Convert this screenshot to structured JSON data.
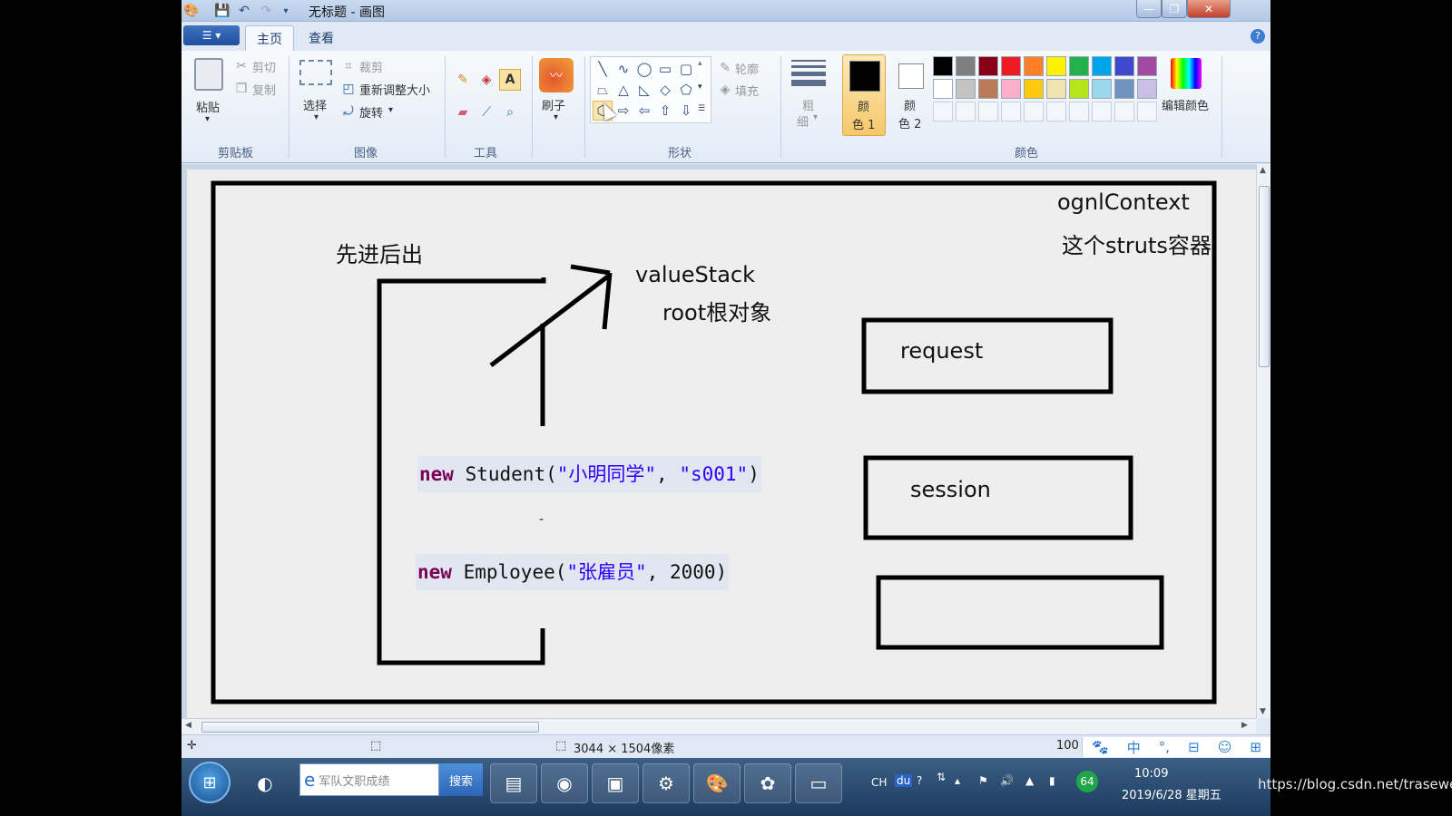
{
  "window": {
    "title": "无标题 - 画图",
    "min_btn": "—",
    "max_btn": "❐",
    "close_btn": "✕"
  },
  "ribbon": {
    "tabs": [
      "主页",
      "查看"
    ],
    "clipboard": {
      "label": "剪贴板",
      "paste": "粘贴",
      "cut": "剪切",
      "copy": "复制"
    },
    "image": {
      "label": "图像",
      "select": "选择",
      "crop": "裁剪",
      "resize": "重新调整大小",
      "rotate": "旋转"
    },
    "tools": {
      "label": "工具"
    },
    "brush": {
      "label": "刷子"
    },
    "shapes": {
      "label": "形状",
      "outline": "轮廓",
      "fill": "填充"
    },
    "size": {
      "label1": "粗",
      "label2": "细"
    },
    "color1": {
      "label1": "颜",
      "label2": "色 1"
    },
    "color2": {
      "label1": "颜",
      "label2": "色 2"
    },
    "colors": {
      "label": "颜色",
      "edit": "编辑颜色",
      "row1": [
        "#000000",
        "#7f7f7f",
        "#880015",
        "#ed1c24",
        "#ff7f27",
        "#fff200",
        "#22b14c",
        "#00a2e8",
        "#3f48cc",
        "#a349a4"
      ],
      "row2": [
        "#ffffff",
        "#c3c3c3",
        "#b97a57",
        "#ffaec9",
        "#ffc90e",
        "#efe4b0",
        "#b5e61d",
        "#99d9ea",
        "#7092be",
        "#c8bfe7"
      ]
    }
  },
  "canvas": {
    "ognl_context": "ognlContext",
    "struts_container": "这个struts容器",
    "fifo_note": "先进后出",
    "value_stack": "valueStack",
    "root_object": "root根对象",
    "request_label": "request",
    "session_label": "session",
    "student_code": {
      "kw": "new",
      "cls": " Student(",
      "s1": "\"小明同学\"",
      "sep": ", ",
      "s2": "\"s001\"",
      "end": ")"
    },
    "employee_code": {
      "kw": "new",
      "cls": " Employee(",
      "s1": "\"张雇员\"",
      "end": ", 2000)"
    },
    "dash": "-"
  },
  "statusbar": {
    "image_size": "3044 × 1504像素",
    "zoom": "100",
    "ime": [
      "中",
      "°,",
      "⊞"
    ]
  },
  "taskbar": {
    "search_placeholder": "军队文职成绩",
    "search_button": "搜索",
    "tray": {
      "lang": "CH",
      "du": "du",
      "badge": "64"
    },
    "time": "10:09",
    "date": "2019/6/28 星期五"
  },
  "watermark": "https://blog.csdn.net/trasewell"
}
